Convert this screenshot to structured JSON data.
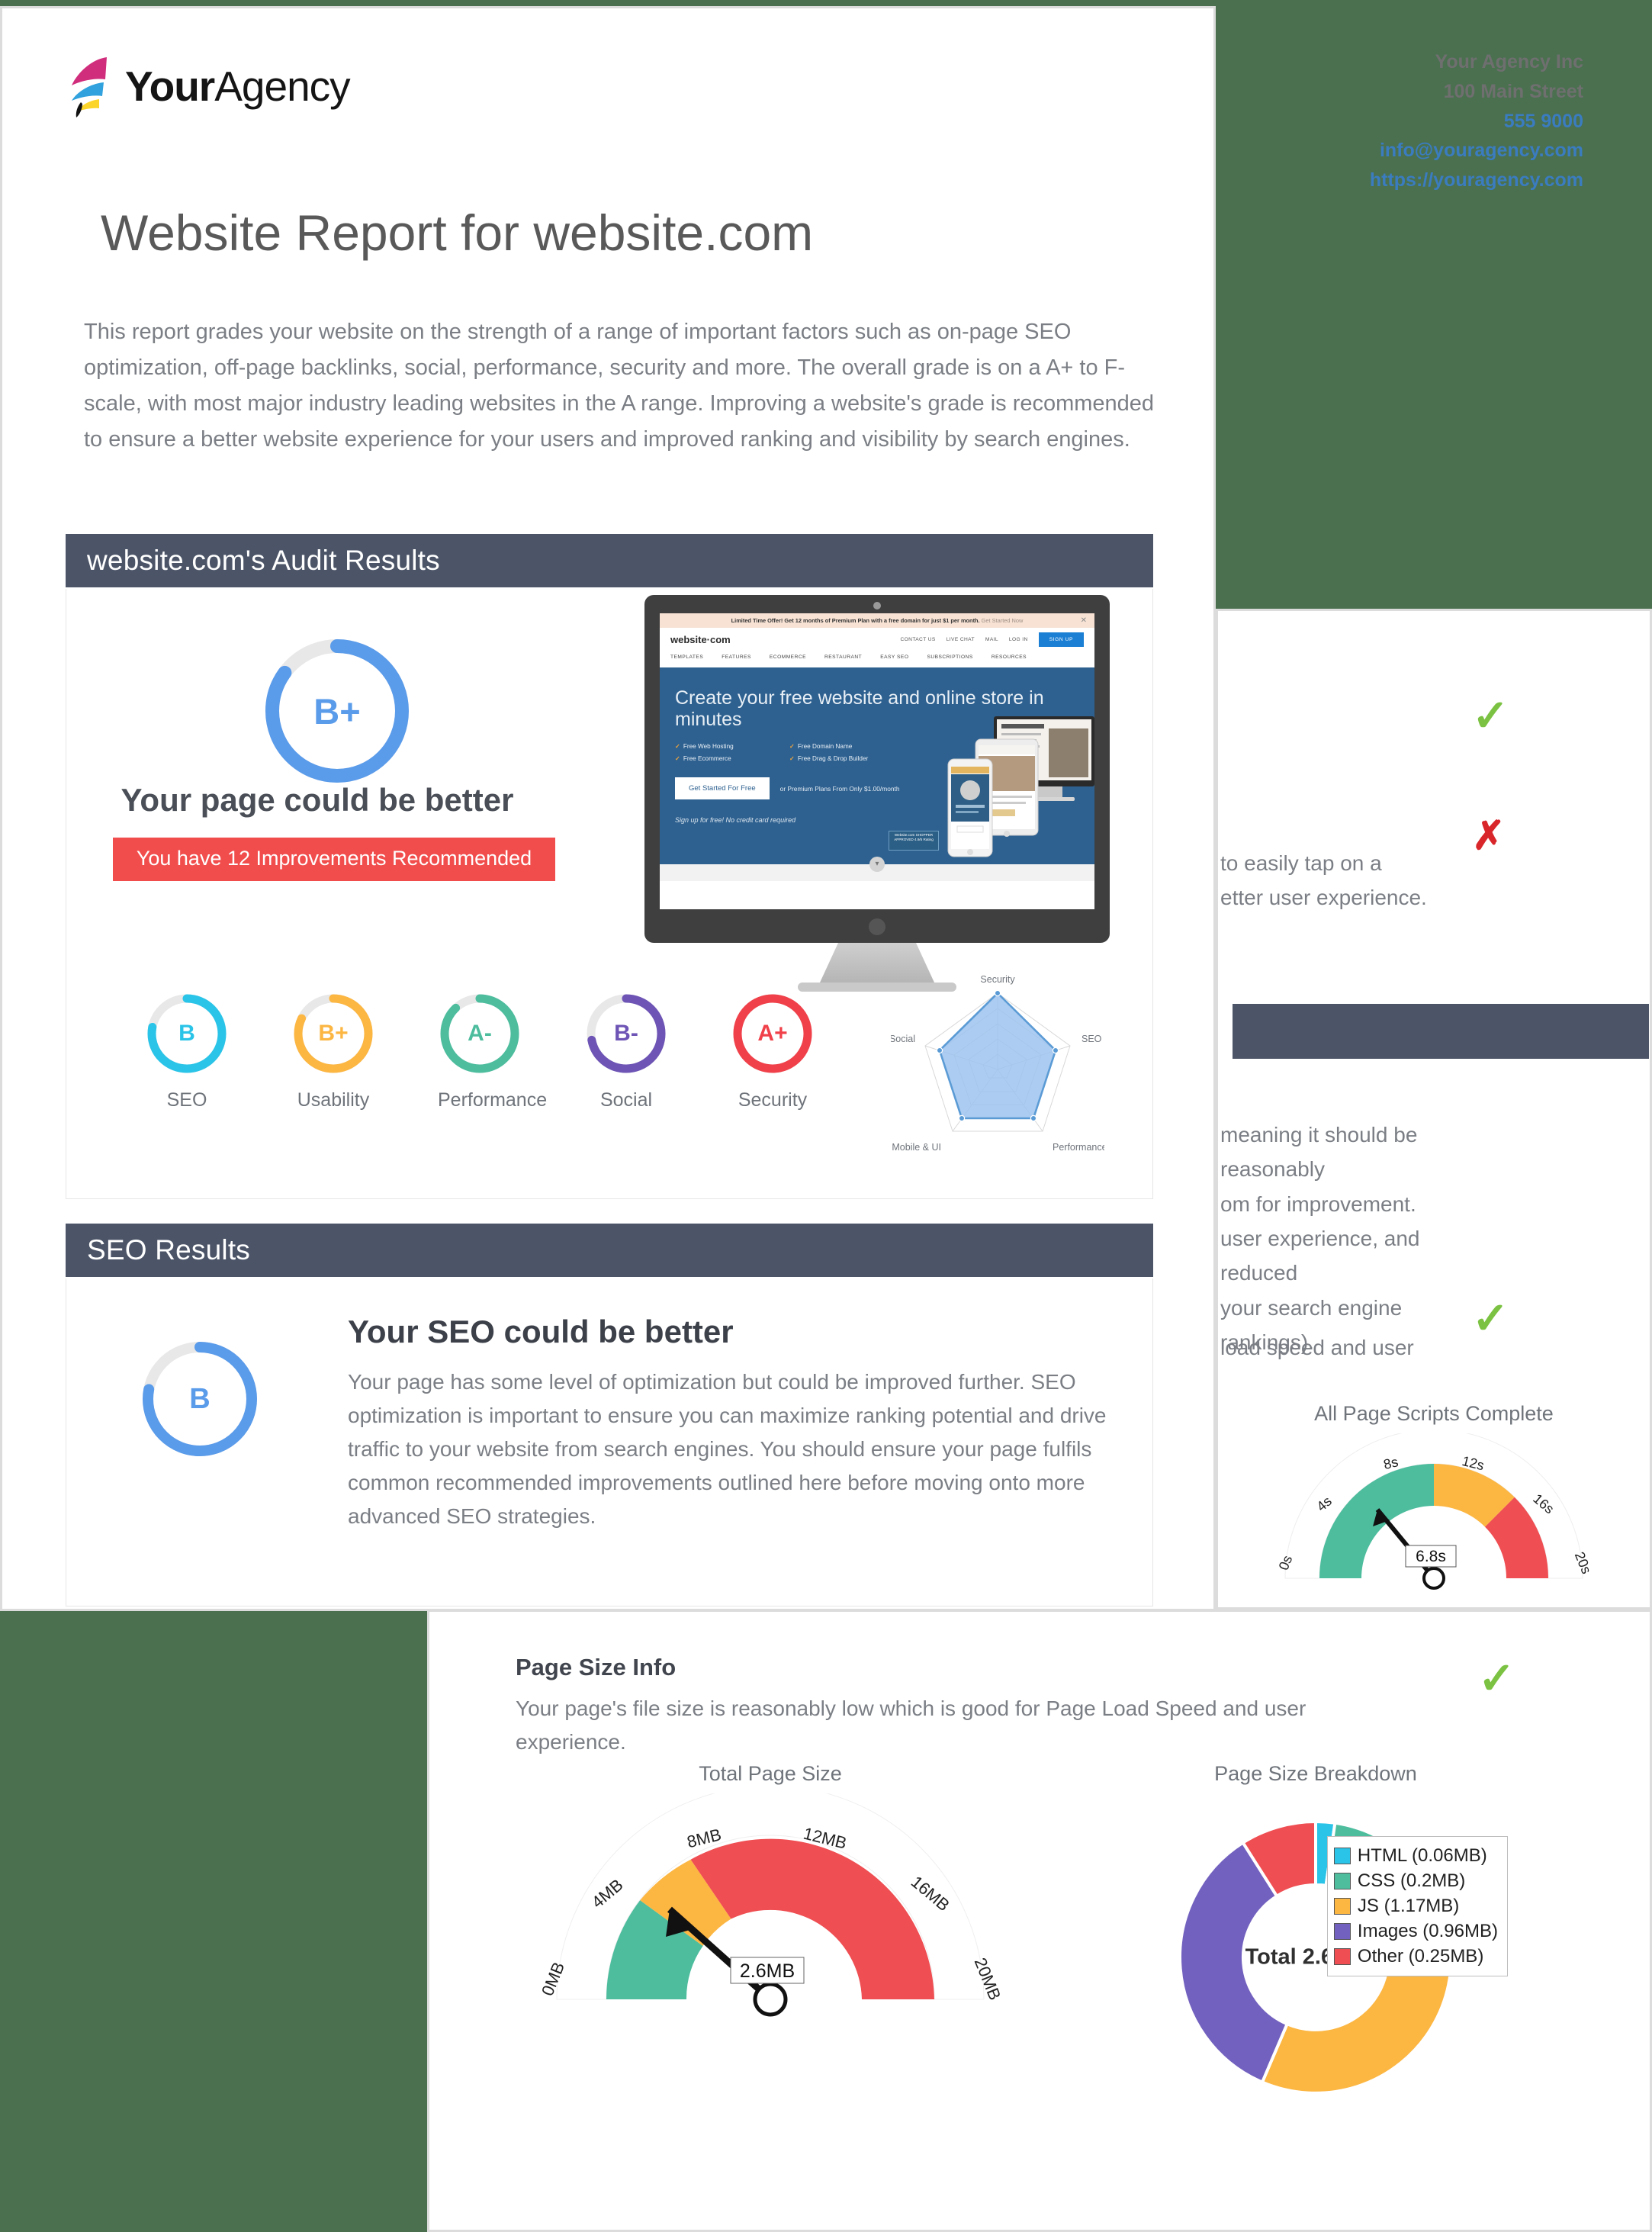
{
  "header": {
    "logo_text_bold": "Your",
    "logo_text_light": "Agency",
    "company": "Your Agency Inc",
    "address": "100 Main Street",
    "phone": "555 9000",
    "email": "info@youragency.com",
    "website": "https://youragency.com"
  },
  "page_title": "Website Report for website.com",
  "intro": "This report grades your website on the strength of a range of important factors such as on-page SEO optimization, off-page backlinks, social, performance, security and more. The overall grade is on a A+ to F-scale, with most major industry leading websites in the A range. Improving a website's grade is recommended to ensure a better website experience for your users and improved ranking and visibility by search engines.",
  "audit": {
    "section_title": "website.com's Audit Results",
    "overall_grade": "B+",
    "overall_percent": 85,
    "headline": "Your page could be better",
    "badge": "You have 12 Improvements Recommended",
    "sub_grades": [
      {
        "grade": "B",
        "label": "SEO",
        "color": "#2ac4e8",
        "percent": 78
      },
      {
        "grade": "B+",
        "label": "Usability",
        "color": "#fcb642",
        "percent": 82
      },
      {
        "grade": "A-",
        "label": "Performance",
        "color": "#4dbd9e",
        "percent": 88
      },
      {
        "grade": "B-",
        "label": "Social",
        "color": "#6d54b5",
        "percent": 72
      },
      {
        "grade": "A+",
        "label": "Security",
        "color": "#f0414a",
        "percent": 100
      }
    ]
  },
  "website_mock": {
    "banner": "Limited Time Offer! Get 12 months of Premium Plan with a free domain for just $1 per month.",
    "banner_cta": "Get Started Now",
    "close_icon": "close-icon",
    "logo": "website·com",
    "top_links": [
      "CONTACT US",
      "LIVE CHAT",
      "MAIL",
      "LOG IN"
    ],
    "signup": "SIGN UP",
    "nav": [
      "TEMPLATES",
      "FEATURES",
      "ECOMMERCE",
      "RESTAURANT",
      "EASY SEO",
      "SUBSCRIPTIONS",
      "RESOURCES"
    ],
    "headline": "Create your free website and online store in minutes",
    "features": [
      "Free Web Hosting",
      "Free Domain Name",
      "Free Ecommerce",
      "Free Drag & Drop Builder"
    ],
    "button": "Get Started For Free",
    "premium": "or Premium Plans From Only $1.00/month",
    "signup_note": "Sign up for free! No credit card required",
    "badge": "Website.com SHOPPER APPROVED 4.9/5 Rating"
  },
  "seo": {
    "section_title": "SEO Results",
    "grade": "B",
    "percent": 78,
    "headline": "Your SEO could be better",
    "body": "Your page has some level of optimization but could be improved further. SEO optimization is important to ensure you can maximize ranking potential and drive traffic to your website from search engines. You should ensure your page fulfils common recommended improvements outlined here before moving onto more advanced SEO strategies."
  },
  "mid_panel": {
    "text_partial_1": "to easily tap on a",
    "text_partial_2": "etter user experience.",
    "text_partial_3": "meaning it should be reasonably",
    "text_partial_4": "om for improvement.",
    "text_partial_5": "user experience, and reduced",
    "text_partial_6": "your search engine rankings).",
    "text_partial_7": "load speed and user",
    "check_icon": "check-icon",
    "cross_icon": "cross-icon"
  },
  "page_size": {
    "title": "Page Size Info",
    "body": "Your page's file size is reasonably low which is good for Page Load Speed and user experience.",
    "status_icon": "check-icon"
  },
  "chart_data": [
    {
      "type": "radar",
      "title": "",
      "categories": [
        "Security",
        "SEO",
        "Performance",
        "Mobile & UI",
        "Social"
      ],
      "values": [
        100,
        80,
        80,
        80,
        80
      ],
      "rmax": 100,
      "rings": 5,
      "fill": "#9dc3ee",
      "stroke": "#5b9bd5",
      "legend": "none"
    },
    {
      "type": "gauge",
      "title": "All Page Scripts Complete",
      "value": 6.8,
      "value_label": "6.8s",
      "min": 0,
      "max": 20,
      "ticks": [
        "0s",
        "4s",
        "8s",
        "12s",
        "16s",
        "20s"
      ],
      "bands": [
        {
          "from": 0,
          "to": 10,
          "color": "#4dbd9e"
        },
        {
          "from": 10,
          "to": 14,
          "color": "#fcb642"
        },
        {
          "from": 14,
          "to": 20,
          "color": "#ef4e52"
        }
      ]
    },
    {
      "type": "gauge",
      "title": "Total Page Size",
      "value": 2.6,
      "value_label": "2.6MB",
      "min": 0,
      "max": 20,
      "ticks": [
        "0MB",
        "4MB",
        "8MB",
        "12MB",
        "16MB",
        "20MB"
      ],
      "bands": [
        {
          "from": 0,
          "to": 3,
          "color": "#4dbd9e"
        },
        {
          "from": 3,
          "to": 5,
          "color": "#fcb642"
        },
        {
          "from": 5,
          "to": 20,
          "color": "#ef4e52"
        }
      ]
    },
    {
      "type": "pie",
      "title": "Page Size Breakdown",
      "center_label": "Total 2.65 MB",
      "labels": [
        "HTML (0.06MB)",
        "CSS (0.2MB)",
        "JS (1.17MB)",
        "Images (0.96MB)",
        "Other (0.25MB)"
      ],
      "values": [
        0.06,
        0.2,
        1.17,
        0.96,
        0.25
      ],
      "colors": [
        "#2ac4e8",
        "#4dbd9e",
        "#fcb642",
        "#7361bf",
        "#ef4e52"
      ],
      "legend": "right",
      "donut": true
    }
  ]
}
